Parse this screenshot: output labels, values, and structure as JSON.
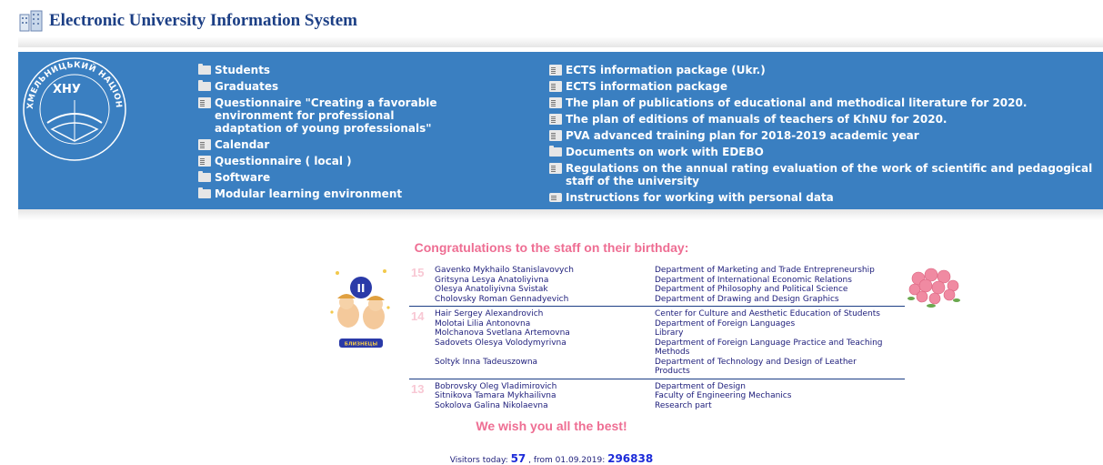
{
  "header": {
    "title": "Electronic University Information System",
    "icon": "building-icon"
  },
  "university": {
    "abbr": "ХНУ",
    "arc_text": "ХМЕЛЬНИЦЬКИЙ НАЦІОНАЛЬНИЙ УНІВЕРСИТЕТ"
  },
  "colors": {
    "band": "#3a7fc1",
    "title": "#1c3f85",
    "pink": "#ee6e93"
  },
  "menu_left": [
    {
      "label": "Students",
      "icon": "folder-icon"
    },
    {
      "label": "Graduates",
      "icon": "folder-icon"
    },
    {
      "label": "Questionnaire \"Creating a favorable environment for professional\nadaptation of young professionals\"",
      "icon": "document-icon"
    },
    {
      "label": "Calendar",
      "icon": "document-icon"
    },
    {
      "label": "Questionnaire ( local )",
      "icon": "document-icon"
    },
    {
      "label": "Software",
      "icon": "folder-icon"
    },
    {
      "label": "Modular learning environment",
      "icon": "folder-icon"
    }
  ],
  "menu_right": [
    {
      "label": "ECTS information package (Ukr.)",
      "icon": "document-icon"
    },
    {
      "label": "ECTS information package",
      "icon": "document-icon"
    },
    {
      "label": "The plan of publications of educational and methodical literature for 2020.",
      "icon": "document-icon"
    },
    {
      "label": "The plan of editions of manuals of teachers of KhNU for 2020.",
      "icon": "document-icon"
    },
    {
      "label": "PVA advanced training plan for 2018-2019 academic year",
      "icon": "document-icon"
    },
    {
      "label": "Documents on work with EDEBO",
      "icon": "folder-icon"
    },
    {
      "label": "Regulations on the annual rating evaluation of the work of scientific and pedagogical staff of the university",
      "icon": "document-icon"
    },
    {
      "label": "Instructions for working with personal data",
      "icon": "note-icon"
    }
  ],
  "birthday": {
    "title": "Congratulations to the staff on their birthday:",
    "zodiac_label": "БЛИЗНЕЦЫ",
    "zodiac_symbol": "II",
    "groups": [
      {
        "day": "15",
        "rows": [
          {
            "name": "Gavenko Mykhailo Stanislavovych",
            "dept": "Department of Marketing and Trade Entrepreneurship"
          },
          {
            "name": "Gritsyna Lesya Anatoliyivna",
            "dept": "Department of International Economic Relations"
          },
          {
            "name": "Olesya Anatoliyivna Svistak",
            "dept": "Department of Philosophy and Political Science"
          },
          {
            "name": "Cholovsky Roman Gennadyevich",
            "dept": "Department of Drawing and Design Graphics"
          }
        ]
      },
      {
        "day": "14",
        "rows": [
          {
            "name": "Hair Sergey Alexandrovich",
            "dept": "Center for Culture and Aesthetic Education of Students"
          },
          {
            "name": "Molotai Lilia Antonovna",
            "dept": "Department of Foreign Languages"
          },
          {
            "name": "Molchanova Svetlana Artemovna",
            "dept": "Library"
          },
          {
            "name": "Sadovets Olesya Volodymyrivna",
            "dept": "Department of Foreign Language Practice and Teaching Methods"
          },
          {
            "name": "Soltyk Inna Tadeuszowna",
            "dept": "Department of Technology and Design of Leather Products"
          }
        ]
      },
      {
        "day": "13",
        "rows": [
          {
            "name": "Bobrovsky Oleg Vladimirovich",
            "dept": "Department of Design"
          },
          {
            "name": "Sitnikova Tamara Mykhailivna",
            "dept": "Faculty of Engineering Mechanics"
          },
          {
            "name": "Sokolova Galina Nikolaevna",
            "dept": "Research part"
          }
        ]
      }
    ],
    "wish": "We wish you all the best!"
  },
  "visitors": {
    "today_label": "Visitors today:",
    "today": "57",
    "since_label": ", from 01.09.2019:",
    "total": "296838"
  }
}
